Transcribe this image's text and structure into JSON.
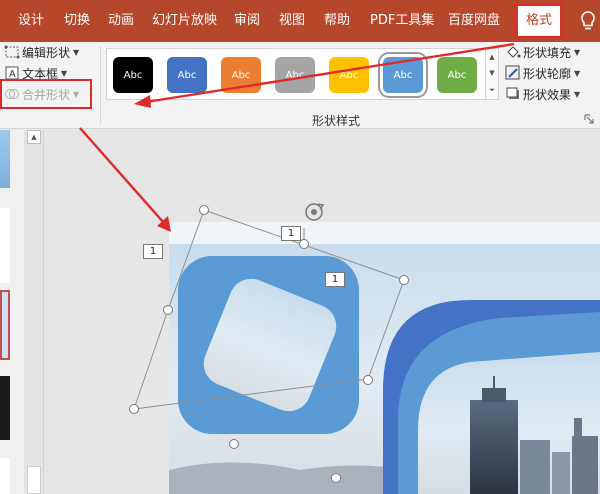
{
  "tabs": [
    "设计",
    "切换",
    "动画",
    "幻灯片放映",
    "审阅",
    "视图",
    "帮助",
    "PDF工具集",
    "百度网盘"
  ],
  "active_tab": "格式",
  "ribbon": {
    "edit_shape": "编辑形状",
    "text_box": "文本框",
    "merge_shapes": "合并形状",
    "style_group_label": "形状样式",
    "styles": [
      {
        "label": "Abc",
        "color": "#000000"
      },
      {
        "label": "Abc",
        "color": "#4472c4"
      },
      {
        "label": "Abc",
        "color": "#ed7d31"
      },
      {
        "label": "Abc",
        "color": "#a5a5a5"
      },
      {
        "label": "Abc",
        "color": "#ffc000"
      },
      {
        "label": "Abc",
        "color": "#5b9bd5"
      },
      {
        "label": "Abc",
        "color": "#70ad47"
      }
    ],
    "selected_style_index": 5,
    "shape_fill": "形状填充",
    "shape_outline": "形状轮廓",
    "shape_effects": "形状效果"
  },
  "canvas": {
    "badge_left": "1",
    "badge_top": "1",
    "badge_inner": "1"
  },
  "colors": {
    "theme": "#b7472a",
    "highlight": "#e02a2a",
    "shape_fill": "#5b9bd5",
    "shape_dark": "#4472c4"
  }
}
